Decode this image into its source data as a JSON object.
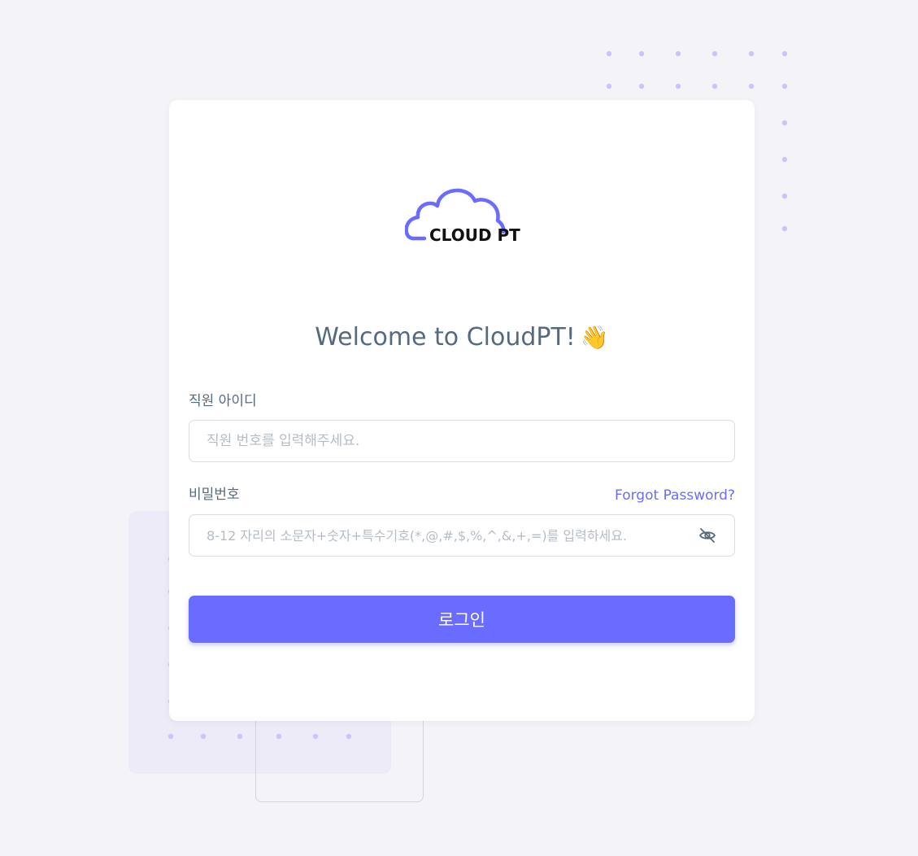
{
  "app": {
    "logo_text": "CLOUD PT",
    "welcome_title": "Welcome to CloudPT!",
    "welcome_emoji": "👋"
  },
  "form": {
    "id_label": "직원 아이디",
    "id_placeholder": "직원 번호를 입력해주세요.",
    "id_value": "",
    "password_label": "비밀번호",
    "forgot_password": "Forgot Password?",
    "password_placeholder": "8-12 자리의 소문자+숫자+특수기호(*,@,#,$,%,^,&,+,=)를 입력하세요.",
    "password_value": "",
    "password_toggle_icon": "eye-off-icon",
    "login_button": "로그인"
  },
  "colors": {
    "primary": "#696cff",
    "background": "#f4f4f8",
    "card": "#ffffff",
    "heading_text": "#566a7f",
    "placeholder": "#b4bdc6",
    "decoration_dots": "#c8c6fb"
  }
}
